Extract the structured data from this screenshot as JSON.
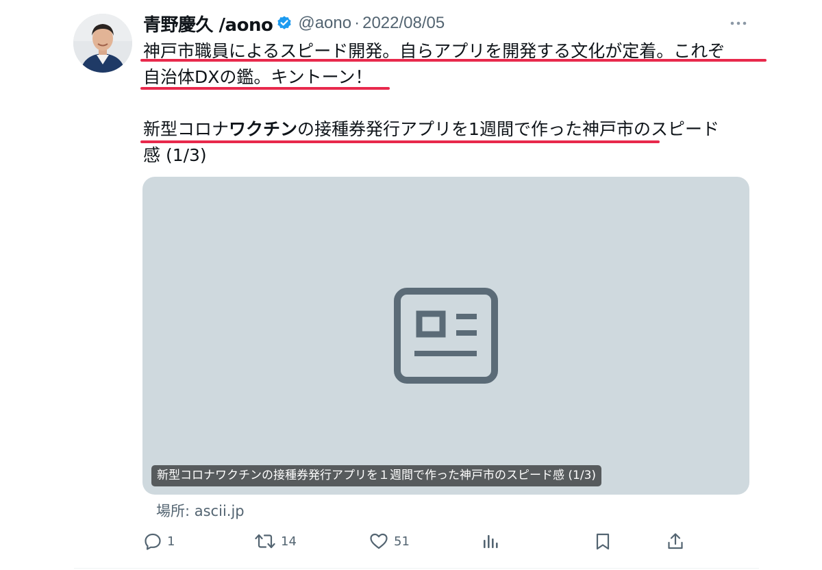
{
  "tweet": {
    "author": {
      "display_name": "青野慶久 /aono",
      "handle": "@aono",
      "verified": true
    },
    "separator": "·",
    "date": "2022/08/05",
    "text": {
      "line1": "神戸市職員によるスピード開発。自らアプリを開発する文化が定着。これぞ",
      "line2": "自治体DXの鑑。キントーン！",
      "line3_a": "新型コロナ",
      "line3_b": "ワクチン",
      "line3_c": "の接種券発行アプリを1週間で作った神戸市のスピード",
      "line4": "感 (1/3)"
    },
    "card": {
      "title": "新型コロナワクチンの接種券発行アプリを１週間で作った神戸市のスピード感 (1/3)",
      "icon": "article-icon"
    },
    "source": "場所: ascii.jp",
    "metrics": {
      "replies": "1",
      "retweets": "14",
      "likes": "51"
    },
    "colors": {
      "underline": "#e8294c",
      "verified": "#1d9bf0",
      "muted": "#536471",
      "card_bg": "#cfd9de"
    }
  }
}
